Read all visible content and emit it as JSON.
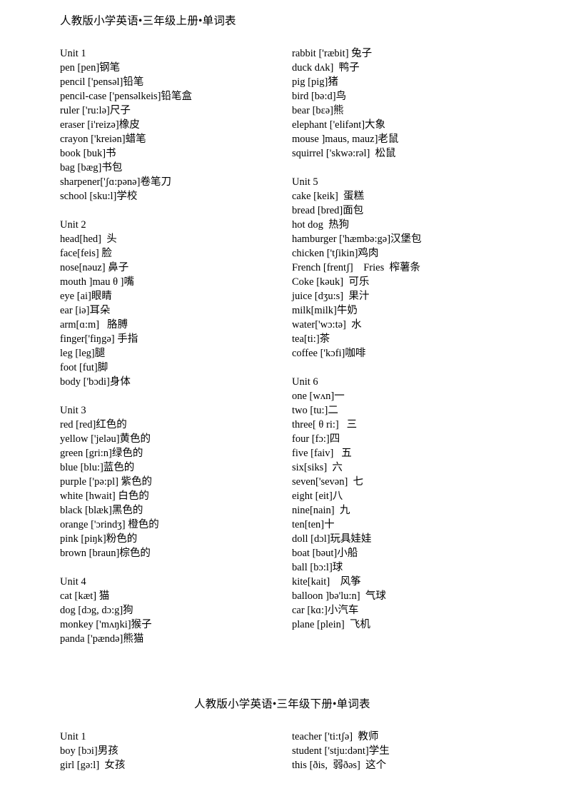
{
  "document": {
    "title_1": "人教版小学英语•三年级上册•单词表",
    "title_2": "人教版小学英语•三年级下册•单词表"
  },
  "section_1": {
    "left_column": [
      {
        "unit_label": "Unit 1",
        "entries": [
          "pen [pen]钢笔",
          "pencil ['pensəl]铅笔",
          "pencil-case ['pensəlkeis]铅笔盒",
          "ruler ['ru:lə]尺子",
          "eraser [i'reizə]橡皮",
          "crayon ['kreiən]蜡笔",
          "book [buk]书",
          "bag [bæg]书包",
          "sharpener['ʃɑ:pənə]卷笔刀",
          "school [sku:l]学校"
        ]
      },
      {
        "unit_label": "Unit 2",
        "entries": [
          "head[hed]  头",
          "face[feis] 脸",
          "nose[nəuz] 鼻子",
          "mouth ]mau θ ]嘴",
          "eye [ai]眼睛",
          "ear [iə]耳朵",
          "arm[ɑ:m]   胳膊",
          "finger['fiŋgə] 手指",
          "leg [leg]腿",
          "foot [fut]脚",
          "body ['bɔdi]身体"
        ]
      },
      {
        "unit_label": "Unit 3",
        "entries": [
          "red [red]红色的",
          "yellow ['jeləu]黄色的",
          "green [gri:n]绿色的",
          "blue [blu:]蓝色的",
          "purple ['pə:pl] 紫色的",
          "white [hwait] 白色的",
          "black [blæk]黑色的",
          "orange ['ɔrindʒ] 橙色的",
          "pink [piŋk]粉色的",
          "brown [braun]棕色的"
        ]
      },
      {
        "unit_label": "Unit 4",
        "entries": [
          "cat [kæt] 猫",
          "dog [dɔg, dɔ:g]狗",
          "monkey ['mʌŋki]猴子",
          "panda ['pændə]熊猫"
        ]
      }
    ],
    "right_column": [
      {
        "unit_label": "",
        "entries": [
          "rabbit ['ræbit] 兔子",
          "duck dʌk]  鸭子",
          "pig [pig]猪",
          "bird [bə:d]鸟",
          "bear [bɛə]熊",
          "elephant ['elifənt]大象",
          "mouse ]maus, mauz]老鼠",
          "squirrel ['skwə:rəl]  松鼠"
        ]
      },
      {
        "unit_label": "Unit 5",
        "entries": [
          "cake [keik]  蛋糕",
          "bread [bred]面包",
          "hot dog  热狗",
          "hamburger ['hæmbə:gə]汉堡包",
          "chicken ['tʃikin]鸡肉",
          "French [frentʃ]    Fries  榨薯条",
          "Coke [kəuk]  可乐",
          "juice [dʒu:s]  果汁",
          "milk[milk]牛奶",
          "water['wɔ:tə]  水",
          "tea[ti:]茶",
          "coffee ['kɔfi]咖啡"
        ]
      },
      {
        "unit_label": "Unit 6",
        "entries": [
          "one [wʌn]一",
          "two [tu:]二",
          "three[ θ ri:]   三",
          "four [fɔ:]四",
          "five [faiv]   五",
          "six[siks]  六",
          "seven['sevən]  七",
          "eight [eit]八",
          "nine[nain]  九",
          "ten[ten]十",
          "doll [dɔl]玩具娃娃",
          "boat [bəut]小船",
          "ball [bɔ:l]球",
          "kite[kait]    风筝",
          "balloon ]bə'lu:n]  气球",
          "car [kɑ:]小汽车",
          "plane [plein]  飞机"
        ]
      }
    ]
  },
  "section_2": {
    "left_column": [
      {
        "unit_label": "Unit 1",
        "entries": [
          "boy [bɔi]男孩",
          "girl [gə:l]  女孩"
        ]
      }
    ],
    "right_column": [
      {
        "unit_label": "",
        "entries": [
          "teacher ['ti:tʃə]  教师",
          "student ['stju:dənt]学生",
          "this [ðis,  弱ðəs]  这个"
        ]
      }
    ]
  }
}
